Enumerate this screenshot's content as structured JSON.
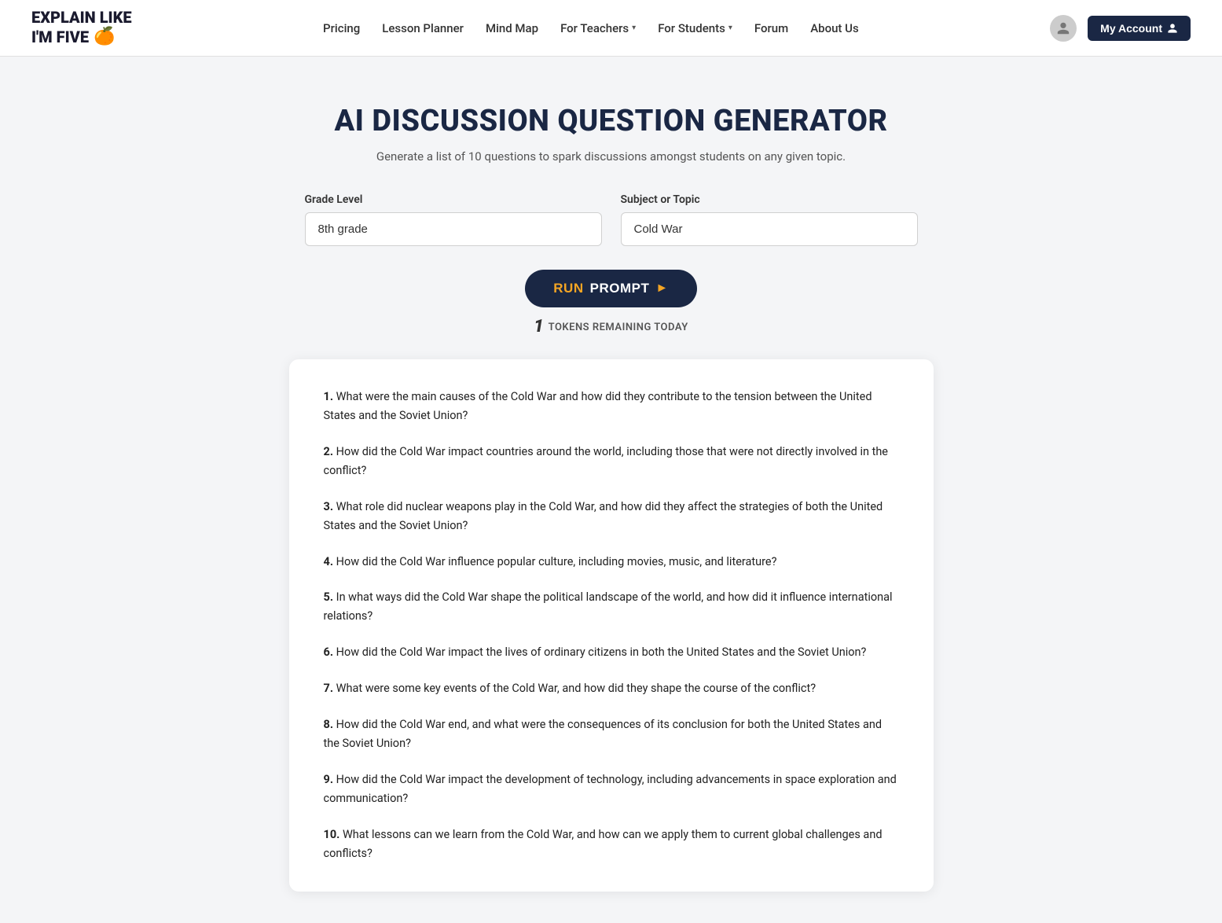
{
  "logo": {
    "line1": "EXPLAIN LIKE",
    "line2": "I'M FIVE",
    "emoji": "🍊"
  },
  "nav": {
    "links": [
      {
        "label": "Pricing",
        "hasDropdown": false
      },
      {
        "label": "Lesson Planner",
        "hasDropdown": false
      },
      {
        "label": "Mind Map",
        "hasDropdown": false
      },
      {
        "label": "For Teachers",
        "hasDropdown": true
      },
      {
        "label": "For Students",
        "hasDropdown": true
      },
      {
        "label": "Forum",
        "hasDropdown": false
      },
      {
        "label": "About Us",
        "hasDropdown": false
      }
    ],
    "myAccountLabel": "My Account"
  },
  "page": {
    "title": "AI DISCUSSION QUESTION GENERATOR",
    "subtitle": "Generate a list of 10 questions to spark discussions amongst students on any given topic.",
    "gradeLevelLabel": "Grade Level",
    "gradeLevelValue": "8th grade",
    "subjectLabel": "Subject or Topic",
    "subjectValue": "Cold War",
    "runButtonRun": "RUN",
    "runButtonPrompt": "PROMPT",
    "tokensNumber": "1",
    "tokensLabel": "TOKENS REMAINING TODAY"
  },
  "questions": [
    {
      "number": "1.",
      "text": "What were the main causes of the Cold War and how did they contribute to the tension between the United States and the Soviet Union?"
    },
    {
      "number": "2.",
      "text": "How did the Cold War impact countries around the world, including those that were not directly involved in the conflict?"
    },
    {
      "number": "3.",
      "text": "What role did nuclear weapons play in the Cold War, and how did they affect the strategies of both the United States and the Soviet Union?"
    },
    {
      "number": "4.",
      "text": "How did the Cold War influence popular culture, including movies, music, and literature?"
    },
    {
      "number": "5.",
      "text": "In what ways did the Cold War shape the political landscape of the world, and how did it influence international relations?"
    },
    {
      "number": "6.",
      "text": "How did the Cold War impact the lives of ordinary citizens in both the United States and the Soviet Union?"
    },
    {
      "number": "7.",
      "text": "What were some key events of the Cold War, and how did they shape the course of the conflict?"
    },
    {
      "number": "8.",
      "text": "How did the Cold War end, and what were the consequences of its conclusion for both the United States and the Soviet Union?"
    },
    {
      "number": "9.",
      "text": "How did the Cold War impact the development of technology, including advancements in space exploration and communication?"
    },
    {
      "number": "10.",
      "text": "What lessons can we learn from the Cold War, and how can we apply them to current global challenges and conflicts?"
    }
  ]
}
